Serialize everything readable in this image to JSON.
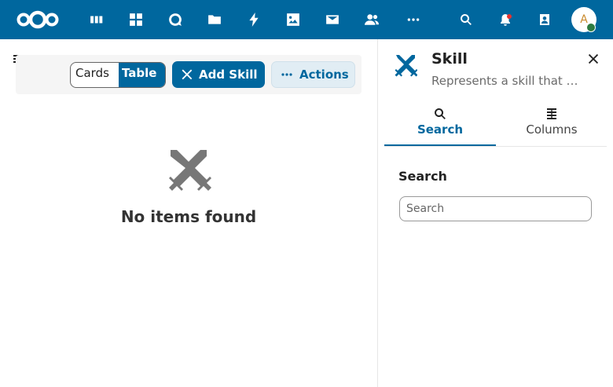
{
  "topbar": {
    "apps": [
      "dashboard-icon",
      "apps-icon",
      "talk-icon",
      "files-icon",
      "activity-icon",
      "photos-icon",
      "mail-icon",
      "contacts-icon",
      "more-apps-icon"
    ],
    "right": [
      "search-icon",
      "notifications-icon",
      "contacts-menu-icon"
    ],
    "avatar_initial": "A",
    "colors": {
      "brand": "#00679e",
      "status_online": "#2d7b41",
      "notification": "#e9322d"
    }
  },
  "toolbar": {
    "view_cards": "Cards",
    "view_table": "Table",
    "add_label": "Add Skill",
    "actions_label": "Actions"
  },
  "main": {
    "empty_message": "No items found"
  },
  "sidebar": {
    "title": "Skill",
    "subtitle": "Represents a skill that …",
    "tabs": [
      {
        "label": "Search",
        "icon": "magnify-icon",
        "active": true
      },
      {
        "label": "Columns",
        "icon": "columns-icon",
        "active": false
      }
    ],
    "search_heading": "Search",
    "search_placeholder": "Search",
    "search_value": ""
  }
}
